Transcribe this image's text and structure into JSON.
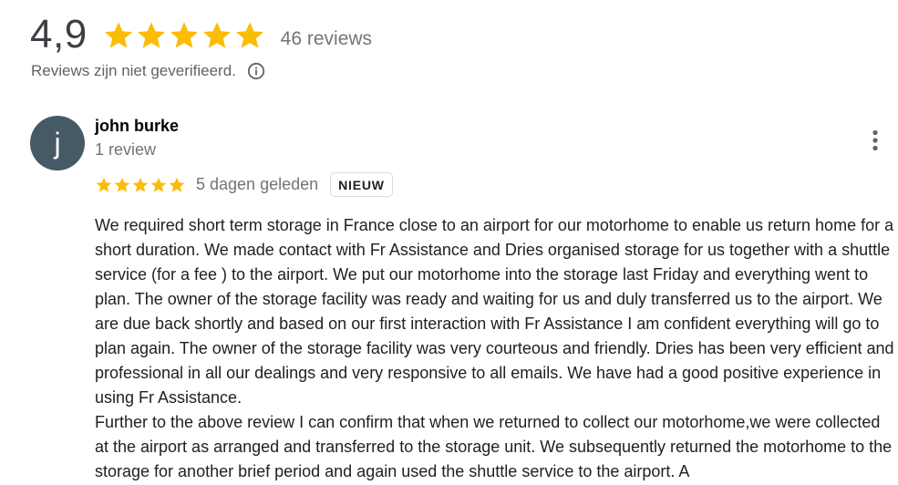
{
  "summary": {
    "rating": "4,9",
    "stars_filled": 5,
    "review_count": "46 reviews",
    "unverified_note": "Reviews zijn niet geverifieerd."
  },
  "colors": {
    "star": "#fbbc04",
    "avatar_bg": "#455a64",
    "muted_text": "#70757a"
  },
  "icons": {
    "info": "info-circle-icon",
    "more": "more-vert-icon",
    "star": "star-icon"
  },
  "review": {
    "avatar_letter": "j",
    "author": "john burke",
    "author_meta": "1 review",
    "stars": 5,
    "date": "5 dagen geleden",
    "badge": "NIEUW",
    "text": "We required short term storage in France close to an airport for our motorhome to enable us return home for a short duration. We made contact with Fr Assistance and Dries organised storage for us together with a shuttle service (for a fee ) to the airport. We put our motorhome into the storage last Friday and everything went to plan. The owner of the storage facility was ready and waiting for us and duly transferred us to the airport. We are due back shortly and based on our first interaction with Fr Assistance I am confident everything will go to plan again. The owner of the storage facility was very courteous and friendly. Dries has been very efficient and professional in all our dealings and very responsive to all emails. We have had a good positive experience in using Fr Assistance.\nFurther to the above review I can confirm that when we returned to collect our motorhome,we were collected at the airport as arranged and transferred to the storage unit. We subsequently returned the motorhome to the storage for another brief period and again used the shuttle service to the airport. A"
  }
}
